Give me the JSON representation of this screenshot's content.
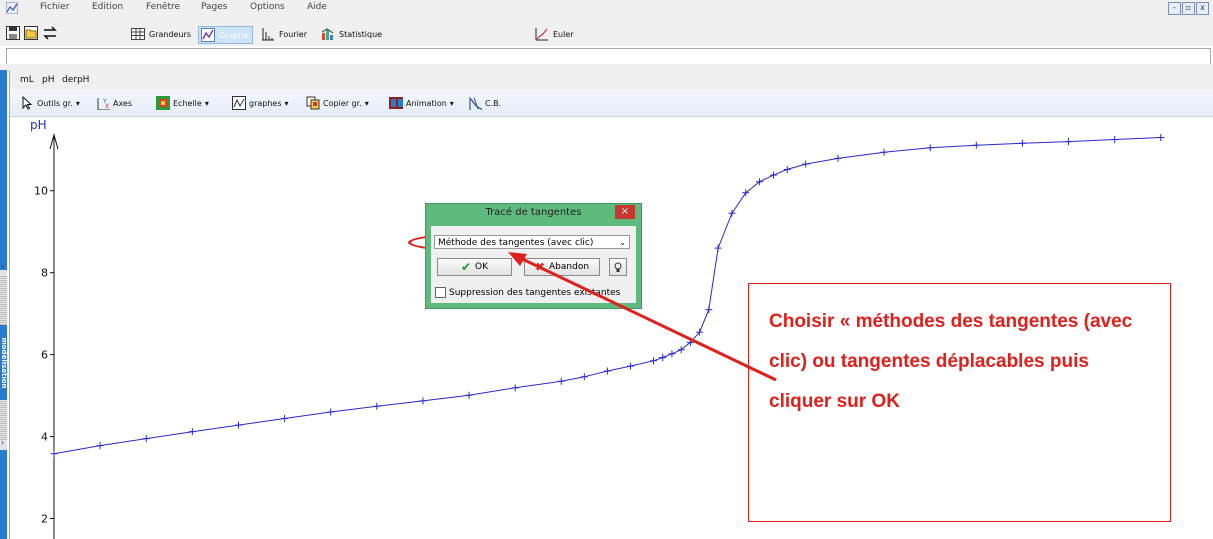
{
  "menu": {
    "items": [
      "Fichier",
      "Edition",
      "Fenêtre",
      "Pages",
      "Options",
      "Aide"
    ]
  },
  "window_buttons": [
    "-",
    "▫",
    "x"
  ],
  "toolbar": {
    "tabs": [
      {
        "label": "Grandeurs",
        "icon": "table-icon",
        "active": false
      },
      {
        "label": "Graphe",
        "icon": "graph-icon",
        "active": true
      },
      {
        "label": "Fourier",
        "icon": "fourier-bars-icon",
        "active": false
      },
      {
        "label": "Statistique",
        "icon": "statistics-icon",
        "active": false
      }
    ],
    "euler_label": "Euler"
  },
  "variables_bar": {
    "items": [
      "mL",
      "pH",
      "derpH"
    ]
  },
  "graph_toolbar": {
    "items": [
      {
        "label": "Outils gr.",
        "icon": "cursor-icon",
        "dropdown": true
      },
      {
        "label": "Axes",
        "icon": "axes-icon",
        "dropdown": false
      },
      {
        "label": "Echelle",
        "icon": "scale-icon",
        "dropdown": true
      },
      {
        "label": "graphes",
        "icon": "graphs-icon",
        "dropdown": true
      },
      {
        "label": "Copier gr.",
        "icon": "copy-icon",
        "dropdown": true
      },
      {
        "label": "Animation",
        "icon": "animation-icon",
        "dropdown": true
      },
      {
        "label": "C.B.",
        "icon": "cb-icon",
        "dropdown": false
      }
    ]
  },
  "side_panel": {
    "label": "modélisation"
  },
  "chart_data": {
    "type": "line",
    "ylabel": "pH",
    "yticks": [
      2,
      4,
      6,
      8,
      10
    ],
    "ylim": [
      1.5,
      11.8
    ],
    "xlim": [
      0,
      24.2
    ],
    "series": [
      {
        "color": "#2a2ad0",
        "marker": "plus",
        "x": [
          0,
          1,
          2,
          3,
          4,
          5,
          6,
          7,
          8,
          9,
          10,
          11,
          11.5,
          12,
          12.5,
          13,
          13.2,
          13.4,
          13.6,
          13.8,
          14.0,
          14.2,
          14.4,
          14.7,
          15.0,
          15.3,
          15.6,
          15.9,
          16.3,
          17,
          18,
          19,
          20,
          21,
          22,
          23,
          24
        ],
        "y": [
          3.58,
          3.78,
          3.95,
          4.12,
          4.28,
          4.44,
          4.6,
          4.74,
          4.87,
          5.01,
          5.19,
          5.35,
          5.46,
          5.6,
          5.72,
          5.85,
          5.93,
          6.02,
          6.12,
          6.3,
          6.55,
          7.1,
          8.6,
          9.45,
          9.95,
          10.22,
          10.38,
          10.52,
          10.65,
          10.79,
          10.94,
          11.05,
          11.11,
          11.16,
          11.2,
          11.25,
          11.3
        ]
      }
    ]
  },
  "dialog": {
    "title": "Tracé de tangentes",
    "close_label": "×",
    "method_value": "Méthode des tangentes (avec clic)",
    "ok_label": "OK",
    "abandon_label": "Abandon",
    "checkbox_label": "Suppression des tangentes existantes"
  },
  "annotation": {
    "text": "Choisir « méthodes des tangentes (avec clic) ou tangentes déplacables puis cliquer sur OK",
    "color": "#e0201b"
  }
}
